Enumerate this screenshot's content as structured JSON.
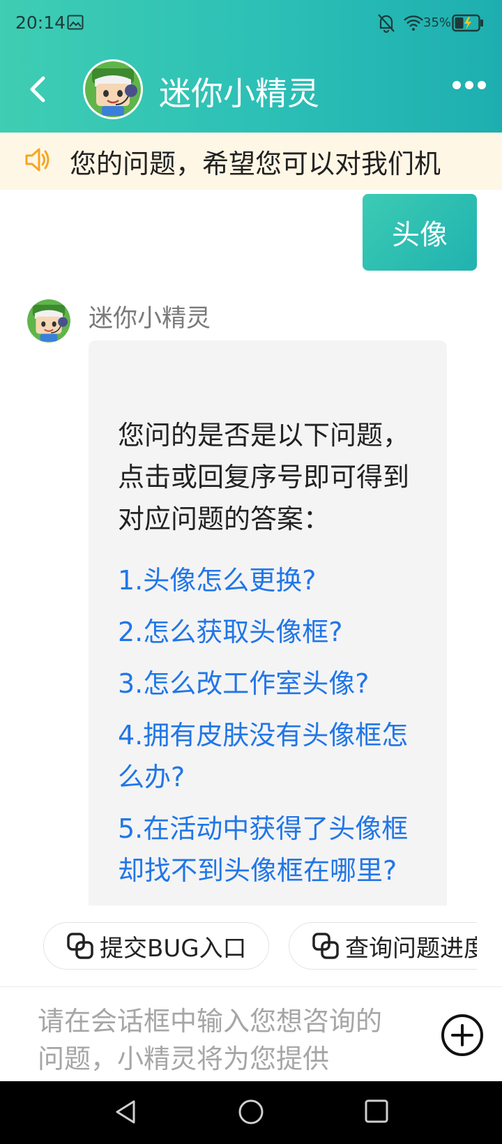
{
  "status_bar": {
    "time": "20:14",
    "battery": "35%"
  },
  "header": {
    "title": "迷你小精灵"
  },
  "notice": {
    "text": "您的问题，希望您可以对我们机"
  },
  "chat": {
    "user_message": "头像",
    "bot_name": "迷你小精灵",
    "bot_intro": "您问的是否是以下问题，点击或回复序号即可得到对应问题的答案：",
    "questions": [
      "1.头像怎么更换?",
      "2.怎么获取头像框?",
      "3.怎么改工作室头像?",
      "4.拥有皮肤没有头像框怎么办?",
      "5.在活动中获得了头像框却找不到头像框在哪里?"
    ]
  },
  "quick_actions": [
    {
      "label": "提交BUG入口",
      "icon": "link-icon"
    },
    {
      "label": "查询问题进度",
      "icon": "link-icon"
    }
  ],
  "input": {
    "placeholder": "请在会话框中输入您想咨询的问题，小精灵将为您提供"
  },
  "colors": {
    "header_start": "#3fcdb3",
    "header_end": "#1eaeb0",
    "link": "#2176e8",
    "notice_bg": "#fff7e6",
    "speaker": "#f5a623"
  }
}
